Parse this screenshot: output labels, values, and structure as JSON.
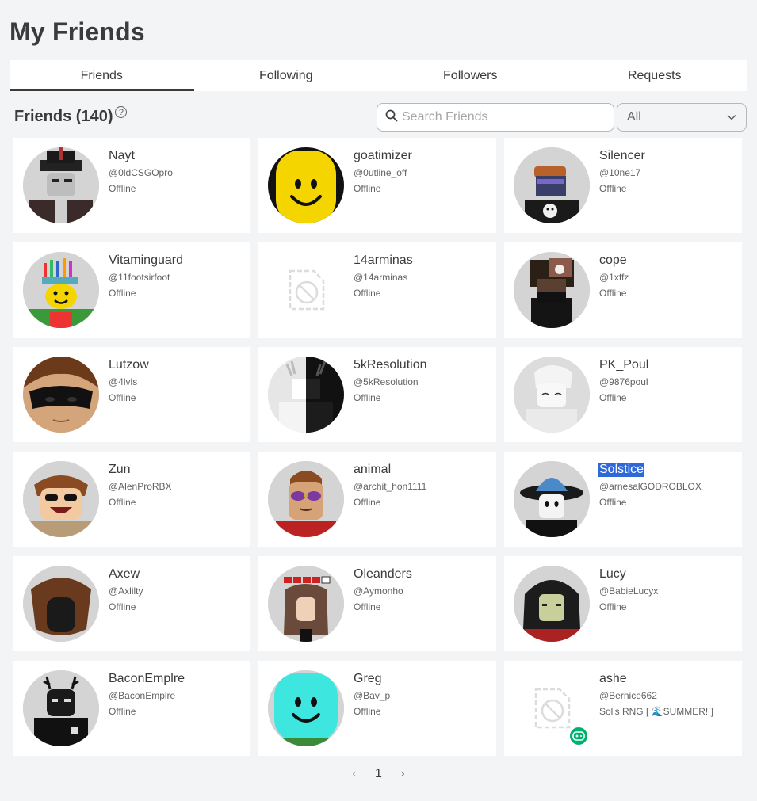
{
  "page": {
    "title": "My Friends"
  },
  "tabs": [
    {
      "label": "Friends",
      "active": true
    },
    {
      "label": "Following",
      "active": false
    },
    {
      "label": "Followers",
      "active": false
    },
    {
      "label": "Requests",
      "active": false
    }
  ],
  "section": {
    "title": "Friends (140)",
    "help_icon": "?"
  },
  "search": {
    "placeholder": "Search Friends",
    "value": ""
  },
  "filter": {
    "selected": "All"
  },
  "friends": [
    {
      "name": "Nayt",
      "username": "@0ldCSGOpro",
      "status": "Offline"
    },
    {
      "name": "goatimizer",
      "username": "@0utline_off",
      "status": "Offline"
    },
    {
      "name": "Silencer",
      "username": "@10ne17",
      "status": "Offline"
    },
    {
      "name": "Vitaminguard",
      "username": "@11footsirfoot",
      "status": "Offline"
    },
    {
      "name": "14arminas",
      "username": "@14arminas",
      "status": "Offline"
    },
    {
      "name": "cope",
      "username": "@1xffz",
      "status": "Offline"
    },
    {
      "name": "Lutzow",
      "username": "@4lvls",
      "status": "Offline"
    },
    {
      "name": "5kResolution",
      "username": "@5kResolution",
      "status": "Offline"
    },
    {
      "name": "PK_Poul",
      "username": "@9876poul",
      "status": "Offline"
    },
    {
      "name": "Zun",
      "username": "@AlenProRBX",
      "status": "Offline"
    },
    {
      "name": "animal",
      "username": "@archit_hon1111",
      "status": "Offline"
    },
    {
      "name": "Solstice",
      "username": "@arnesalGODROBLOX",
      "status": "Offline"
    },
    {
      "name": "Axew",
      "username": "@Axlilty",
      "status": "Offline"
    },
    {
      "name": "Oleanders",
      "username": "@Aymonho",
      "status": "Offline"
    },
    {
      "name": "Lucy",
      "username": "@BabieLucyx",
      "status": "Offline"
    },
    {
      "name": "BaconEmplre",
      "username": "@BaconEmplre",
      "status": "Offline"
    },
    {
      "name": "Greg",
      "username": "@Bav_p",
      "status": "Offline"
    },
    {
      "name": "ashe",
      "username": "@Bernice662",
      "status": "Sol's RNG [ 🌊SUMMER! ]"
    }
  ],
  "pagination": {
    "prev": "‹",
    "current": "1",
    "next": "›"
  },
  "colors": {
    "background": "#f2f4f5",
    "card": "#ffffff",
    "text": "#393b3d",
    "secondary_text": "#606264",
    "selection": "#2f68d8",
    "in_game": "#00b06f"
  }
}
